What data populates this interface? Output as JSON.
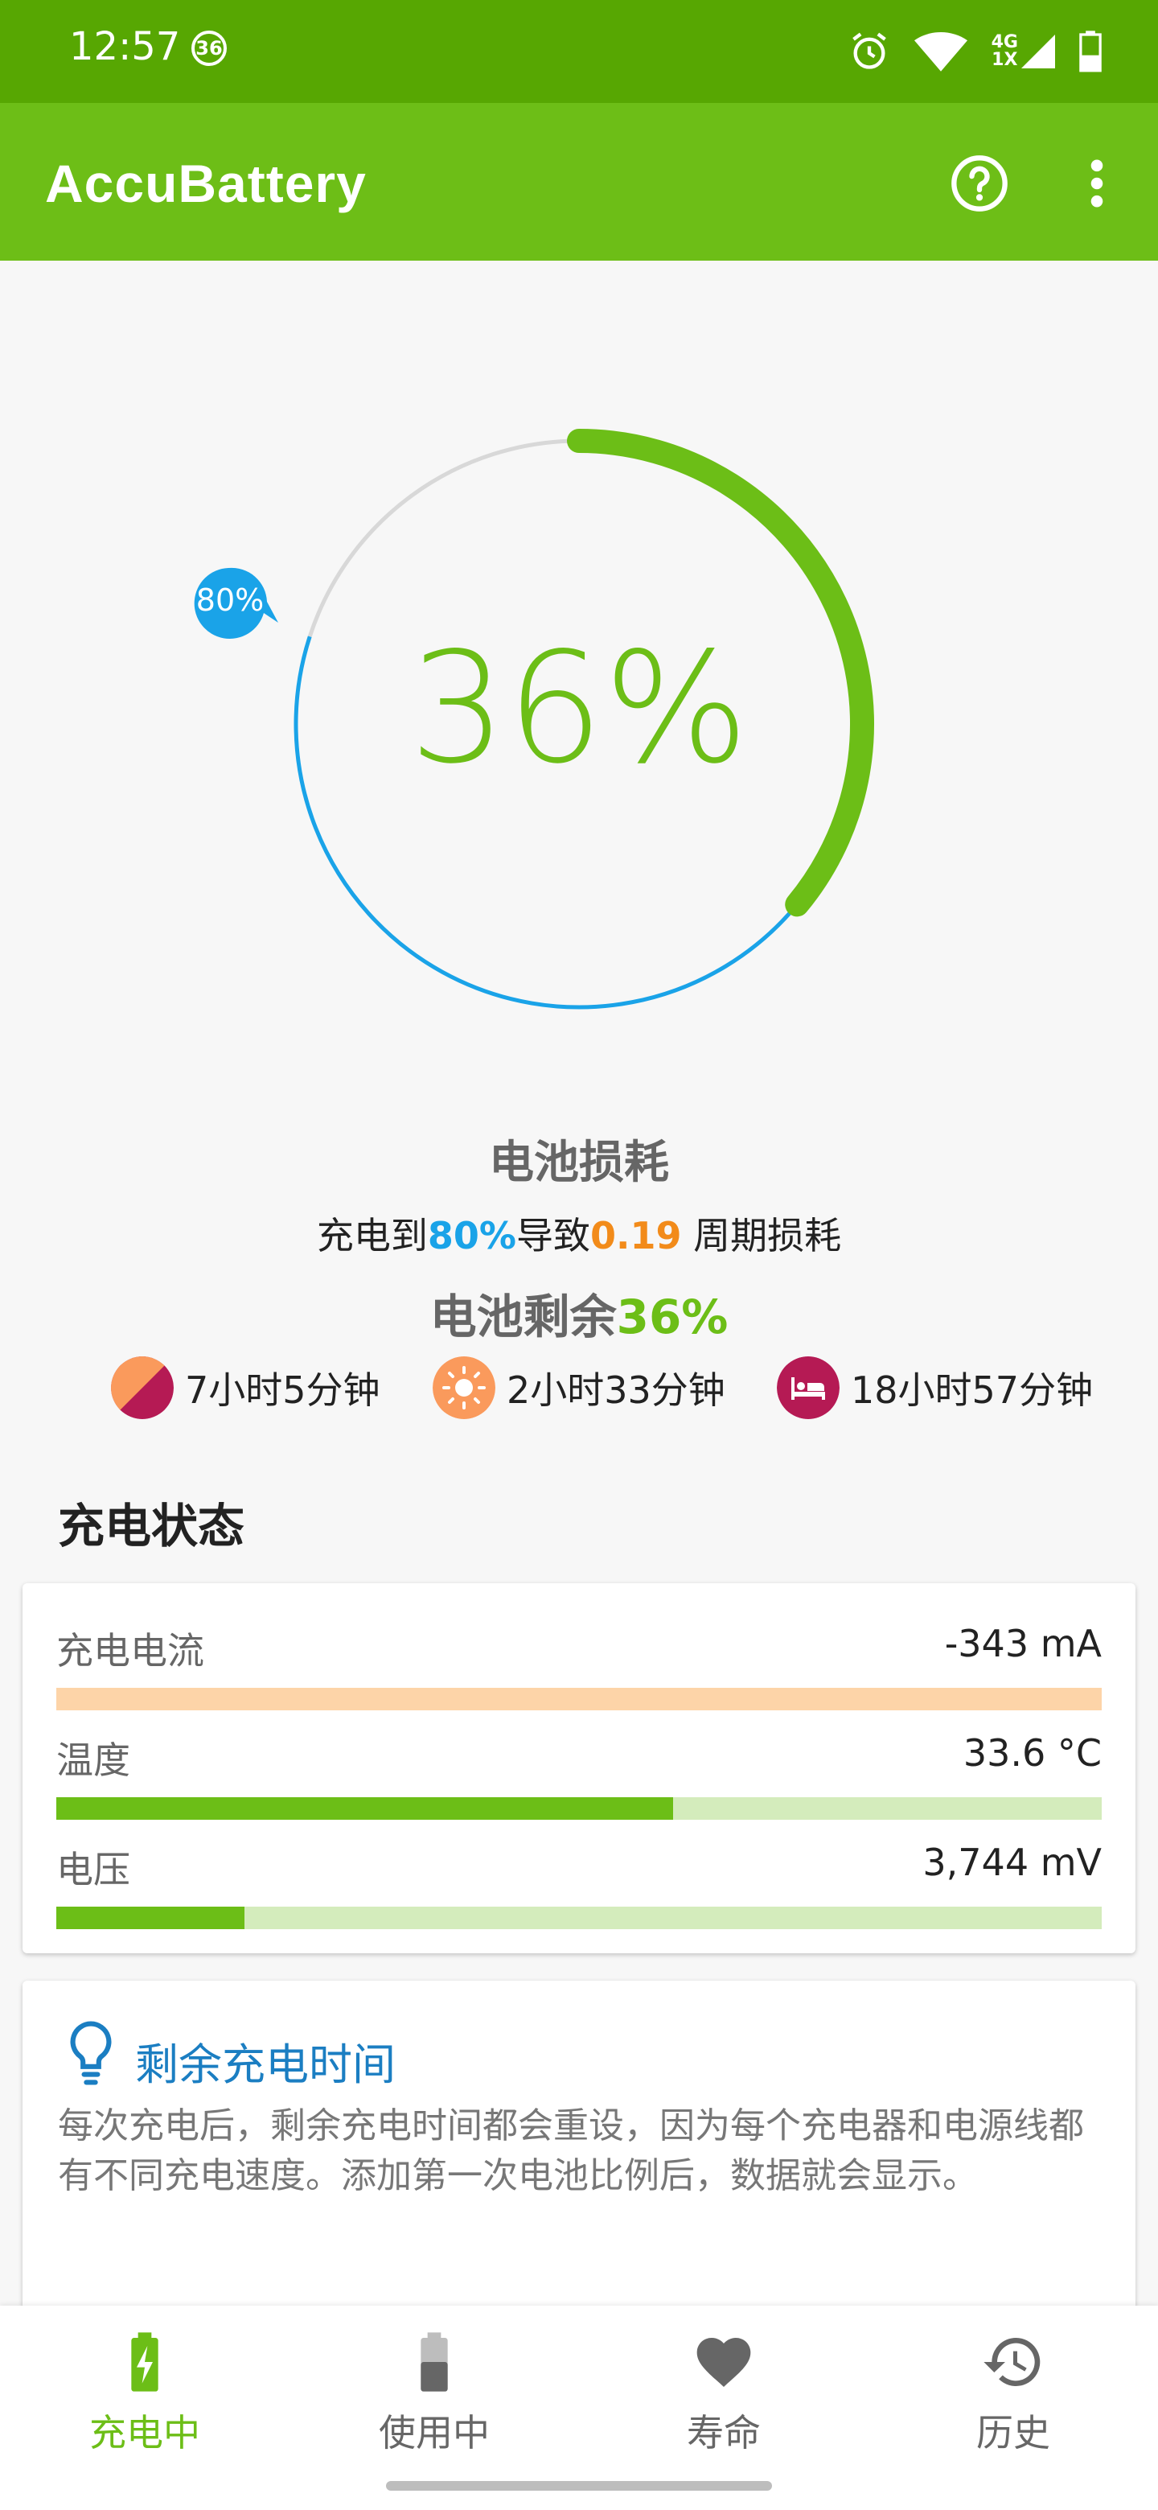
{
  "status_bar": {
    "time": "12:57",
    "notif_badge": "36",
    "net_top": "4G",
    "net_bottom": "1X"
  },
  "app_bar": {
    "title": "AccuBattery",
    "help_icon": "help-circle-icon",
    "menu_icon": "more-vert-icon"
  },
  "gauge": {
    "percent_label": "36%",
    "charge_fraction": 0.36,
    "target_label": "80%",
    "target_fraction": 0.8
  },
  "wear": {
    "title": "电池损耗",
    "desc_prefix": "充电到",
    "desc_target": "80%",
    "desc_mid": "导致",
    "desc_cycles": "0.19",
    "desc_suffix": " 周期损耗"
  },
  "remaining": {
    "prefix": "电池剩余",
    "percent": "36%",
    "estimates": [
      {
        "icon": "screen-mixed-icon",
        "label": "7小时5分钟"
      },
      {
        "icon": "screen-on-icon",
        "label": "2小时33分钟"
      },
      {
        "icon": "sleep-bed-icon",
        "label": "18小时57分钟"
      }
    ]
  },
  "charge_status": {
    "title": "充电状态",
    "rows": [
      {
        "label": "充电电流",
        "value": "-343 mA",
        "fill": 0.0,
        "fill_color": "#fdd4a8",
        "track_color": "#fdd4a8"
      },
      {
        "label": "温度",
        "value": "33.6 °C",
        "fill": 0.59,
        "fill_color": "#6cbe17",
        "track_color": "#d4ecbc"
      },
      {
        "label": "电压",
        "value": "3,744 mV",
        "fill": 0.18,
        "fill_color": "#6cbe17",
        "track_color": "#d4ecbc"
      }
    ]
  },
  "tip": {
    "icon": "lightbulb-icon",
    "title": "剩余充电时间",
    "text": "每次充电后，剩余充电时间都会重设，因为每个充电器和电源线都有不同充电速度。添加第一次电池比例后，数据就会显示。"
  },
  "bottom_nav": [
    {
      "icon": "battery-charging-icon",
      "label": "充电中",
      "active": true
    },
    {
      "icon": "battery-discharging-icon",
      "label": "使用中",
      "active": false
    },
    {
      "icon": "heart-icon",
      "label": "寿命",
      "active": false
    },
    {
      "icon": "history-icon",
      "label": "历史",
      "active": false
    }
  ],
  "colors": {
    "accent": "#6cbe17",
    "blue": "#1aa3e8",
    "orange": "#f28b1a"
  }
}
